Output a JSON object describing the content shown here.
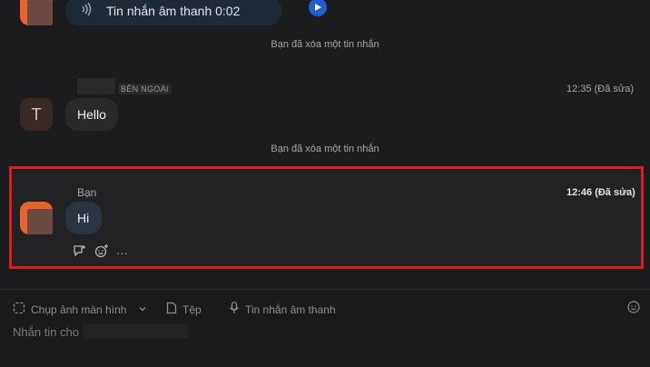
{
  "voice": {
    "label": "Tin nhắn âm thanh 0:02"
  },
  "notes": {
    "deleted_1": "Bạn đã xóa một tin nhắn",
    "deleted_2": "Bạn đã xóa một tin nhắn"
  },
  "message1": {
    "badge": "BÊN NGOÀI",
    "avatar_letter": "T",
    "text": "Hello",
    "time": "12:35 (Đã sửa)"
  },
  "message2": {
    "sender": "Bạn",
    "text": "Hi",
    "time": "12:46 (Đã sửa)"
  },
  "toolbar": {
    "screenshot_label": "Chụp ảnh màn hình",
    "file_label": "Tệp",
    "voice_label": "Tin nhắn âm thanh",
    "input_placeholder": "Nhắn tin cho"
  },
  "colors": {
    "accent_orange": "#e8632f",
    "highlight": "#e11b22",
    "play_blue": "#1f5fd6"
  }
}
